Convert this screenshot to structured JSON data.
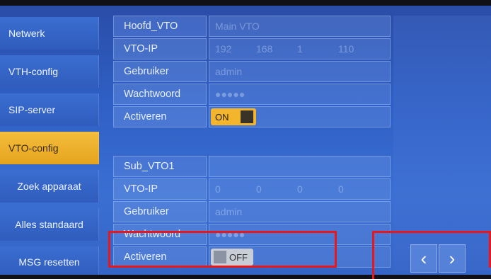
{
  "sidebar": {
    "items": [
      {
        "label": "Netwerk",
        "active": false
      },
      {
        "label": "VTH-config",
        "active": false
      },
      {
        "label": "SIP-server",
        "active": false
      },
      {
        "label": "VTO-config",
        "active": true
      },
      {
        "label": "Zoek apparaat",
        "active": false
      },
      {
        "label": "Alles standaard",
        "active": false
      },
      {
        "label": "MSG resetten",
        "active": false
      }
    ]
  },
  "main_vto": {
    "header_label": "Hoofd_VTO",
    "header_value": "Main VTO",
    "ip_label": "VTO-IP",
    "ip": [
      "192",
      "168",
      "1",
      "110"
    ],
    "user_label": "Gebruiker",
    "user_value": "admin",
    "password_label": "Wachtwoord",
    "password_value": "●●●●●",
    "enable_label": "Activeren",
    "enable_state": "ON"
  },
  "sub_vto": {
    "header_label": "Sub_VTO1",
    "header_value": "",
    "ip_label": "VTO-IP",
    "ip": [
      "0",
      "0",
      "0",
      "0"
    ],
    "user_label": "Gebruiker",
    "user_value": "admin",
    "password_label": "Wachtwoord",
    "password_value": "●●●●●",
    "enable_label": "Activeren",
    "enable_state": "OFF"
  },
  "navigation": {
    "prev_icon": "chevron-left-icon",
    "next_icon": "chevron-right-icon",
    "prev_glyph": "‹",
    "next_glyph": "›"
  },
  "colors": {
    "accent": "#f2b52c",
    "highlight": "#e8171b",
    "background": "#2f5fc4"
  }
}
